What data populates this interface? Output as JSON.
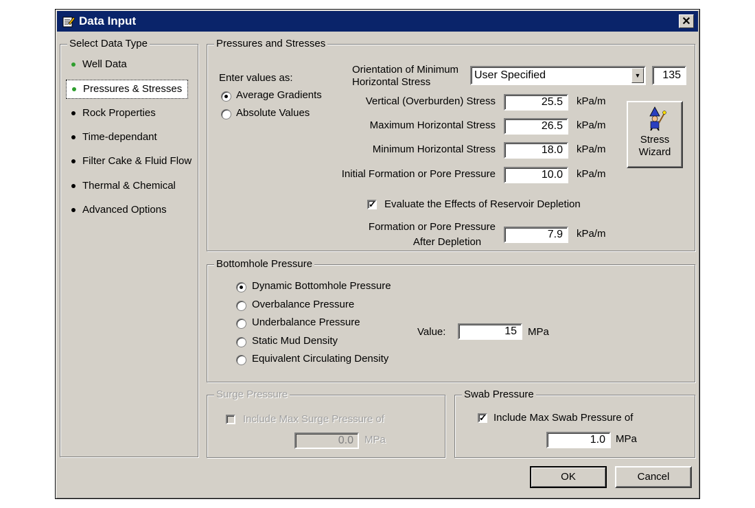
{
  "window": {
    "title": "Data Input",
    "close_label": "✕"
  },
  "sidebar": {
    "legend": "Select Data Type",
    "items": [
      {
        "label": "Well Data",
        "bullet": "green"
      },
      {
        "label": "Pressures & Stresses",
        "bullet": "green",
        "selected": true
      },
      {
        "label": "Rock Properties",
        "bullet": "black"
      },
      {
        "label": "Time-dependant",
        "bullet": "black"
      },
      {
        "label": "Filter Cake & Fluid Flow",
        "bullet": "black"
      },
      {
        "label": "Thermal & Chemical",
        "bullet": "black"
      },
      {
        "label": "Advanced Options",
        "bullet": "black"
      }
    ]
  },
  "pressures": {
    "legend": "Pressures and Stresses",
    "enter_values_as": "Enter values as:",
    "option_avg": "Average Gradients",
    "option_abs": "Absolute Values",
    "orientation_label_1": "Orientation of Minimum",
    "orientation_label_2": "Horizontal Stress",
    "orientation_select": "User Specified",
    "orientation_value": "135",
    "vertical_label": "Vertical (Overburden) Stress",
    "vertical_value": "25.5",
    "max_h_label": "Maximum Horizontal Stress",
    "max_h_value": "26.5",
    "min_h_label": "Minimum Horizontal Stress",
    "min_h_value": "18.0",
    "pore_label": "Initial Formation or Pore Pressure",
    "pore_value": "10.0",
    "unit": "kPa/m",
    "wizard_line1": "Stress",
    "wizard_line2": "Wizard",
    "depletion_check_label": "Evaluate the Effects of Reservoir Depletion",
    "depletion_label_1": "Formation or Pore Pressure",
    "depletion_label_2": "After Depletion",
    "depletion_value": "7.9"
  },
  "bottomhole": {
    "legend": "Bottomhole Pressure",
    "options": [
      {
        "label": "Dynamic Bottomhole Pressure",
        "checked": true
      },
      {
        "label": "Overbalance Pressure",
        "checked": false
      },
      {
        "label": "Underbalance Pressure",
        "checked": false
      },
      {
        "label": "Static Mud Density",
        "checked": false
      },
      {
        "label": "Equivalent Circulating Density",
        "checked": false
      }
    ],
    "value_label": "Value:",
    "value": "15",
    "unit": "MPa"
  },
  "surge": {
    "legend": "Surge Pressure",
    "check_label": "Include Max Surge Pressure of",
    "value": "0.0",
    "unit": "MPa"
  },
  "swab": {
    "legend": "Swab Pressure",
    "check_label": "Include Max Swab Pressure of",
    "value": "1.0",
    "unit": "MPa"
  },
  "buttons": {
    "ok": "OK",
    "cancel": "Cancel"
  },
  "colors": {
    "titlebar": "#0a246a",
    "dialog": "#d4d0c8",
    "bullet_active": "#2e9e2e"
  }
}
